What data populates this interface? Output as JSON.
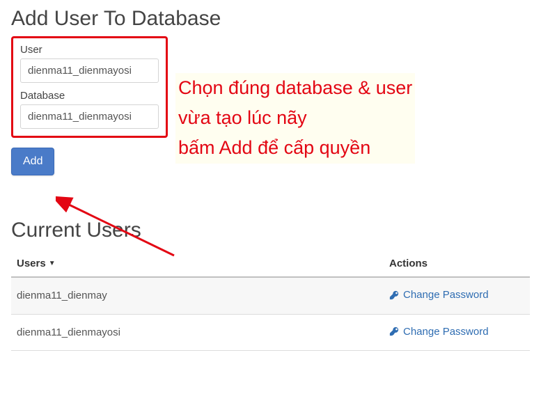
{
  "addSection": {
    "title": "Add User To Database",
    "userLabel": "User",
    "userValue": "dienma11_dienmayosi",
    "databaseLabel": "Database",
    "databaseValue": "dienma11_dienmayosi",
    "addButton": "Add"
  },
  "annotation": {
    "line1": "Chọn đúng database & user",
    "line2": "vừa tạo lúc nãy",
    "line3": "bấm Add để cấp quyền"
  },
  "currentUsers": {
    "title": "Current Users",
    "columns": {
      "users": "Users",
      "actions": "Actions"
    },
    "rows": [
      {
        "username": "dienma11_dienmay",
        "action": "Change Password"
      },
      {
        "username": "dienma11_dienmayosi",
        "action": "Change Password"
      }
    ]
  }
}
